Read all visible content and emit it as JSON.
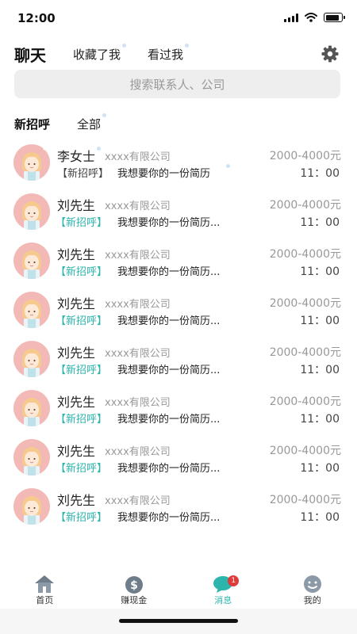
{
  "status_bar": {
    "time": "12:00",
    "battery_level": 0.85
  },
  "top_tabs": {
    "chat": "聊天",
    "favorited": "收藏了我",
    "viewed": "看过我"
  },
  "search": {
    "placeholder": "搜索联系人、公司"
  },
  "sub_tabs": {
    "new_greeting": "新招呼",
    "all": "全部"
  },
  "conversations": [
    {
      "name": "李女士",
      "company": "xxxx有限公司",
      "salary": "2000-4000元",
      "tag": "【新招呼】",
      "message": "我想要你的一份简历",
      "time": "11：00"
    },
    {
      "name": "刘先生",
      "company": "xxxx有限公司",
      "salary": "2000-4000元",
      "tag": "【新招呼】",
      "message": "我想要你的一份简历...",
      "time": "11：00"
    },
    {
      "name": "刘先生",
      "company": "xxxx有限公司",
      "salary": "2000-4000元",
      "tag": "【新招呼】",
      "message": "我想要你的一份简历...",
      "time": "11：00"
    },
    {
      "name": "刘先生",
      "company": "xxxx有限公司",
      "salary": "2000-4000元",
      "tag": "【新招呼】",
      "message": "我想要你的一份简历...",
      "time": "11：00"
    },
    {
      "name": "刘先生",
      "company": "xxxx有限公司",
      "salary": "2000-4000元",
      "tag": "【新招呼】",
      "message": "我想要你的一份简历...",
      "time": "11：00"
    },
    {
      "name": "刘先生",
      "company": "xxxx有限公司",
      "salary": "2000-4000元",
      "tag": "【新招呼】",
      "message": "我想要你的一份简历...",
      "time": "11：00"
    },
    {
      "name": "刘先生",
      "company": "xxxx有限公司",
      "salary": "2000-4000元",
      "tag": "【新招呼】",
      "message": "我想要你的一份简历...",
      "time": "11：00"
    },
    {
      "name": "刘先生",
      "company": "xxxx有限公司",
      "salary": "2000-4000元",
      "tag": "【新招呼】",
      "message": "我想要你的一份简历...",
      "time": "11：00"
    }
  ],
  "bottom_nav": {
    "home": "首页",
    "earn": "赚现金",
    "messages": "消息",
    "messages_badge": "1",
    "mine": "我的"
  },
  "colors": {
    "accent": "#2bb5ac",
    "badge": "#e03a3a",
    "avatar_bg": "#f3b9b6",
    "search_bg": "#eeeeee"
  },
  "icons": [
    "settings-icon",
    "home-icon",
    "money-icon",
    "chat-icon",
    "profile-icon"
  ]
}
